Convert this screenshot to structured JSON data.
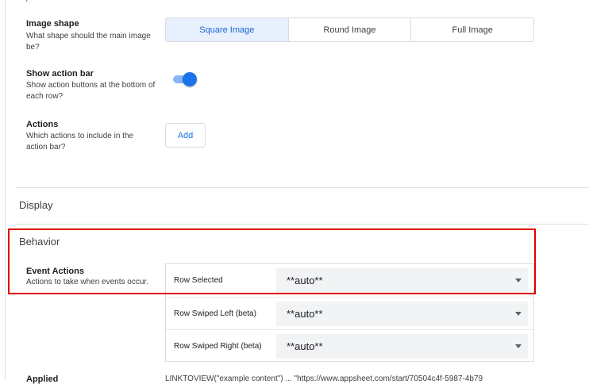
{
  "top_fragment": "/",
  "image_shape": {
    "label": "Image shape",
    "description": "What shape should the main image be?",
    "options": [
      "Square Image",
      "Round Image",
      "Full Image"
    ],
    "selected": "Square Image"
  },
  "action_bar": {
    "label": "Show action bar",
    "description": "Show action buttons at the bottom of each row?",
    "enabled": true
  },
  "actions": {
    "label": "Actions",
    "description": "Which actions to include in the action bar?",
    "add_label": "Add"
  },
  "sections": {
    "display": "Display",
    "behavior": "Behavior"
  },
  "event_actions": {
    "label": "Event Actions",
    "description": "Actions to take when events occur.",
    "rows": [
      {
        "event": "Row Selected",
        "value": "**auto**"
      },
      {
        "event": "Row Swiped Left (beta)",
        "value": "**auto**"
      },
      {
        "event": "Row Swiped Right (beta)",
        "value": "**auto**"
      }
    ]
  },
  "bottom_partial": {
    "label": "Applied",
    "value": "LINKTOVIEW(\"example content\") ... \"https://www.appsheet.com/start/70504c4f-5987-4b79"
  },
  "colors": {
    "accent": "#1a73e8",
    "segment_active_bg": "#e8f0fe",
    "highlight": "#e00000"
  }
}
